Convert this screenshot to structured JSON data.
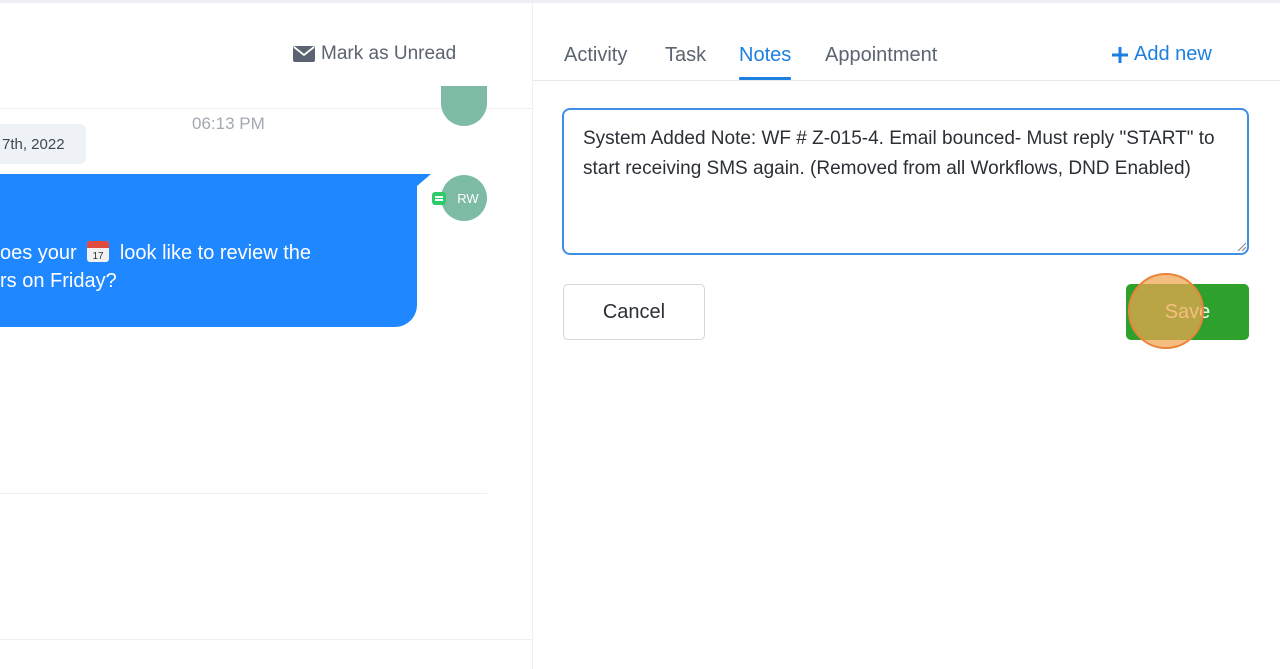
{
  "conversation": {
    "mark_unread_label": "Mark as Unread",
    "date_chip": "7th, 2022",
    "timestamp": "06:13 PM",
    "avatar_initials": "RW",
    "message": {
      "line1_before_emoji": "oes your",
      "line1_after_emoji": "look like to review the",
      "line2": "rs on Friday?"
    }
  },
  "tabs": [
    {
      "label": "Activity",
      "active": false
    },
    {
      "label": "Task",
      "active": false
    },
    {
      "label": "Notes",
      "active": true
    },
    {
      "label": "Appointment",
      "active": false
    }
  ],
  "add_new_label": "Add new",
  "note": {
    "value": "System Added Note: WF # Z-015-4. Email bounced- Must reply \"START\" to start receiving SMS again. (Removed from all Workflows, DND Enabled)"
  },
  "actions": {
    "cancel_label": "Cancel",
    "save_label": "Save"
  },
  "colors": {
    "accent": "#1d7fe0",
    "bubble": "#1f87ff",
    "save": "#2ea12d",
    "avatar": "#7dbba5"
  }
}
